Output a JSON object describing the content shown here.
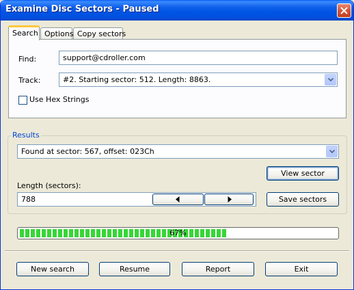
{
  "window": {
    "title": "Examine Disc Sectors - Paused"
  },
  "tabs": [
    {
      "label": "Search",
      "active": true
    },
    {
      "label": "Options",
      "active": false
    },
    {
      "label": "Copy sectors",
      "active": false
    }
  ],
  "search": {
    "find_label": "Find:",
    "find_value": "support@cdroller.com",
    "track_label": "Track:",
    "track_value": "#2. Starting sector: 512. Length: 8863.",
    "hex_label": "Use Hex Strings",
    "hex_checked": false
  },
  "results": {
    "group_title": "Results",
    "found_value": "Found at sector: 567, offset: 023Ch",
    "view_sector_label": "View sector",
    "length_label": "Length (sectors):",
    "length_value": "788",
    "save_sectors_label": "Save sectors"
  },
  "progress": {
    "value": 0.67,
    "text": "67%"
  },
  "footer": {
    "new_search_label": "New search",
    "resume_label": "Resume",
    "report_label": "Report",
    "exit_label": "Exit"
  },
  "colors": {
    "titlebar": "#0054e3",
    "progress_fill": "#37d637",
    "group_title": "#0046d5",
    "tab_highlight": "#ffc83c"
  },
  "icons": {
    "close": "close-icon",
    "dropdown": "chevron-down-icon",
    "left": "arrow-left-icon",
    "right": "arrow-right-icon"
  }
}
